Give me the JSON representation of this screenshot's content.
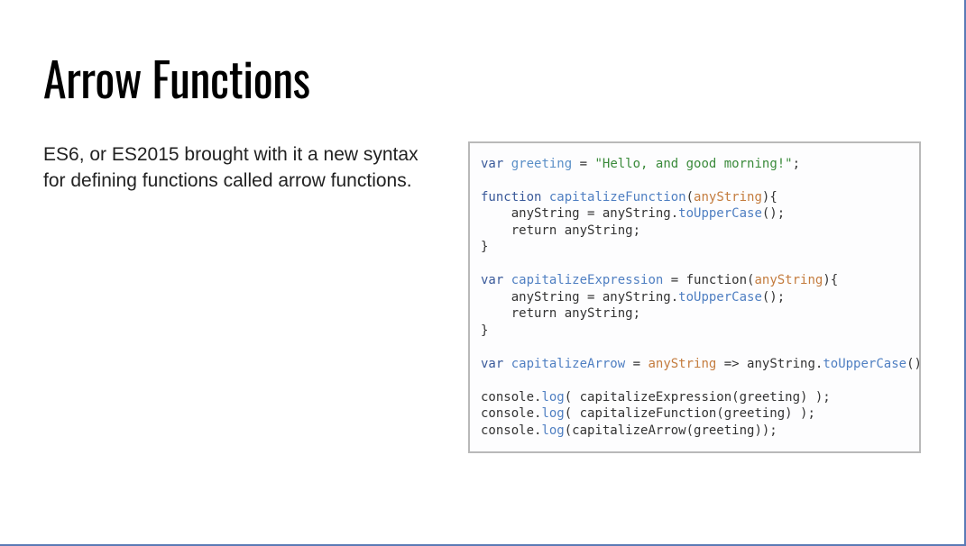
{
  "title": "Arrow Functions",
  "description": "ES6, or ES2015 brought with it a new syntax for defining functions called arrow functions.",
  "code": {
    "line1_var": "var",
    "line1_name": "greeting",
    "line1_eq": " = ",
    "line1_str": "\"Hello, and good morning!\"",
    "line1_end": ";",
    "fn_kw": "function",
    "fn_name": "capitalizeFunction",
    "fn_open": "(",
    "fn_param": "anyString",
    "fn_close": "){",
    "body_assign1": "    anyString = anyString.",
    "body_method": "toUpperCase",
    "body_assign1_end": "();",
    "body_return": "    return anyString;",
    "brace_close": "}",
    "expr_var": "var",
    "expr_name": "capitalizeExpression",
    "expr_mid": " = function(",
    "expr_param": "anyString",
    "expr_close": "){",
    "arrow_var": "var",
    "arrow_name": "capitalizeArrow",
    "arrow_mid": " = ",
    "arrow_param": "anyString",
    "arrow_arrow": " => anyString.",
    "arrow_method": "toUpperCase",
    "arrow_end": "();",
    "log1_pre": "console.",
    "log_method": "log",
    "log1_post": "( capitalizeExpression(greeting) );",
    "log2_post": "( capitalizeFunction(greeting) );",
    "log3_post": "(capitalizeArrow(greeting));"
  }
}
